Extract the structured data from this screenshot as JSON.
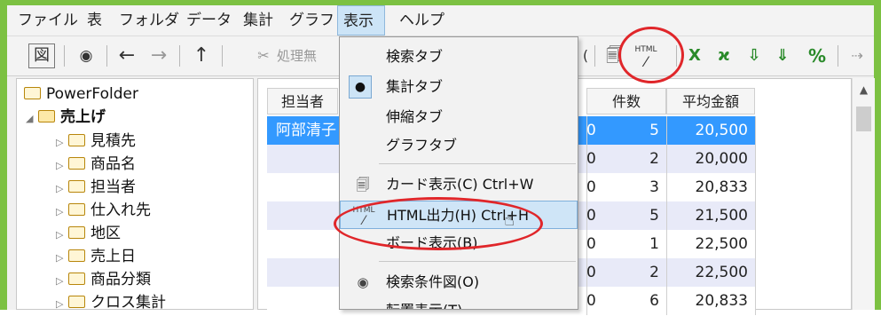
{
  "menubar": {
    "items": [
      "ファイル",
      "表",
      "フォルダ",
      "データ",
      "集計",
      "グラフ",
      "表示",
      "ヘルプ"
    ]
  },
  "toolbar": {
    "view_icon": "図",
    "eye_icon": "◉",
    "back_icon": "←",
    "forward_icon": "→",
    "up_icon": "↑",
    "process_label": "処理無",
    "html_icon_caption": "HTML",
    "x_label": "X",
    "percent_label": "%"
  },
  "tree": {
    "root": "PowerFolder",
    "expanded": "売上げ",
    "children": [
      "見積先",
      "商品名",
      "担当者",
      "仕入れ先",
      "地区",
      "売上日",
      "商品分類",
      "クロス集計"
    ]
  },
  "grid": {
    "headers": {
      "person": "担当者",
      "count": "件数",
      "avg": "平均金額"
    },
    "first_person": "阿部清子",
    "rows": [
      {
        "count_trunc": "0",
        "count": "5",
        "avg": "20,500"
      },
      {
        "count_trunc": "0",
        "count": "2",
        "avg": "20,000"
      },
      {
        "count_trunc": "0",
        "count": "3",
        "avg": "20,833"
      },
      {
        "count_trunc": "0",
        "count": "5",
        "avg": "21,500"
      },
      {
        "count_trunc": "0",
        "count": "1",
        "avg": "22,500"
      },
      {
        "count_trunc": "0",
        "count": "2",
        "avg": "22,500"
      },
      {
        "count_trunc": "0",
        "count": "6",
        "avg": "20,833"
      }
    ]
  },
  "dropdown": {
    "search_tab": "検索タブ",
    "aggregate_tab": "集計タブ",
    "compress_tab": "伸縮タブ",
    "graph_tab": "グラフタブ",
    "card_view": "カード表示(C)   Ctrl+W",
    "html_output": "HTML出力(H)   Ctrl+H",
    "board_view": "ボード表示(B)",
    "search_criteria": "検索条件図(O)",
    "transpose_view": "転置表示(T)",
    "checked_mark": "●"
  },
  "colors": {
    "frame_green": "#7cc142",
    "selection_blue": "#3399ff",
    "highlight_red": "#e0262a"
  }
}
